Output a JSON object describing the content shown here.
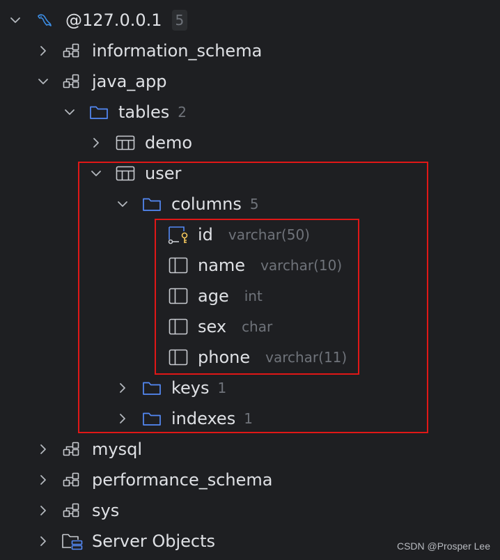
{
  "tree": {
    "root": {
      "label": "@127.0.0.1",
      "count": "5",
      "icon": "mysql-dolphin-icon"
    },
    "information_schema": {
      "label": "information_schema",
      "icon": "schema-icon"
    },
    "java_app": {
      "label": "java_app",
      "icon": "schema-icon"
    },
    "tables": {
      "label": "tables",
      "count": "2",
      "icon": "folder-icon"
    },
    "demo": {
      "label": "demo",
      "icon": "table-icon"
    },
    "user": {
      "label": "user",
      "icon": "table-icon"
    },
    "columns": {
      "label": "columns",
      "count": "5",
      "icon": "folder-icon"
    },
    "column_items": [
      {
        "label": "id",
        "type": "varchar(50)",
        "icon": "primary-key-column-icon"
      },
      {
        "label": "name",
        "type": "varchar(10)",
        "icon": "column-icon"
      },
      {
        "label": "age",
        "type": "int",
        "icon": "column-icon"
      },
      {
        "label": "sex",
        "type": "char",
        "icon": "column-icon"
      },
      {
        "label": "phone",
        "type": "varchar(11)",
        "icon": "column-icon"
      }
    ],
    "keys": {
      "label": "keys",
      "count": "1",
      "icon": "folder-icon"
    },
    "indexes": {
      "label": "indexes",
      "count": "1",
      "icon": "folder-icon"
    },
    "mysql": {
      "label": "mysql",
      "icon": "schema-icon"
    },
    "performance_schema": {
      "label": "performance_schema",
      "icon": "schema-icon"
    },
    "sys": {
      "label": "sys",
      "icon": "schema-icon"
    },
    "server_objects": {
      "label": "Server Objects",
      "icon": "server-objects-icon"
    }
  },
  "watermark": "CSDN @Prosper Lee",
  "colors": {
    "background": "#1e1f22",
    "text": "#dfe1e5",
    "muted": "#6f737a",
    "folder": "#548af7",
    "dolphin": "#3c8ee6",
    "key": "#f2c55c",
    "highlight": "#e01717"
  }
}
